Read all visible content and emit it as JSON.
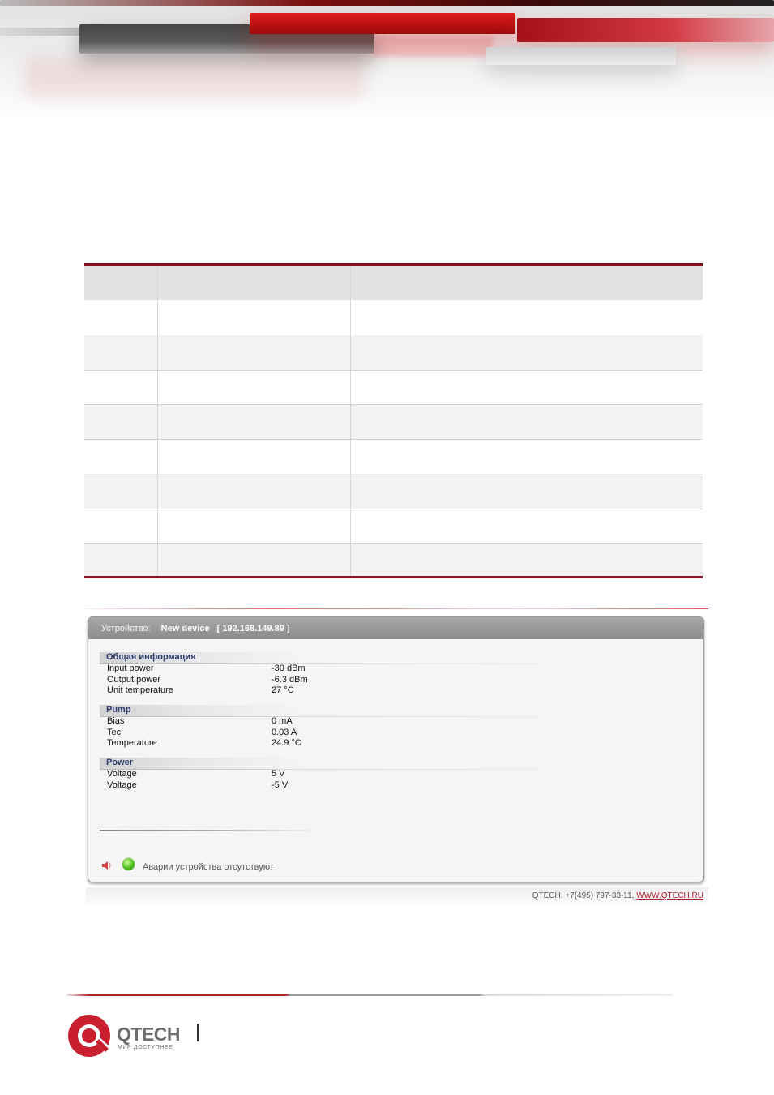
{
  "colors": {
    "accent": "#8c1525",
    "brand_red": "#b01e2a",
    "section_title": "#2b3a6b",
    "status_ok": "#4cbf1a",
    "link": "#b22030"
  },
  "table": {
    "columns": 3,
    "rows": 8
  },
  "device": {
    "label": "Устройство:",
    "name": "New device",
    "ip": "[ 192.168.149.89 ]",
    "sections": [
      {
        "title": "Общая информация",
        "rows": [
          {
            "key": "Input power",
            "value": "-30 dBm"
          },
          {
            "key": "Output power",
            "value": "-6.3 dBm"
          },
          {
            "key": "Unit temperature",
            "value": "27 °C"
          }
        ]
      },
      {
        "title": "Pump",
        "rows": [
          {
            "key": "Bias",
            "value": "0  mA"
          },
          {
            "key": "Tec",
            "value": "0.03 A"
          },
          {
            "key": "Temperature",
            "value": "24.9 °C"
          }
        ]
      },
      {
        "title": "Power",
        "rows": [
          {
            "key": "Voltage",
            "value": "5 V"
          },
          {
            "key": "Voltage",
            "value": "-5 V"
          }
        ]
      }
    ],
    "status_text": "Аварии устройства отсутствуют",
    "status_icon": "green-led-icon",
    "speaker_icon": "speaker-icon"
  },
  "footer": {
    "contact": "QTECH, +7(495) 797-33-11,",
    "link": "WWW.QTECH.RU"
  },
  "logo": {
    "name": "QTECH",
    "tagline": "МИР ДОСТУПНЕЕ"
  }
}
